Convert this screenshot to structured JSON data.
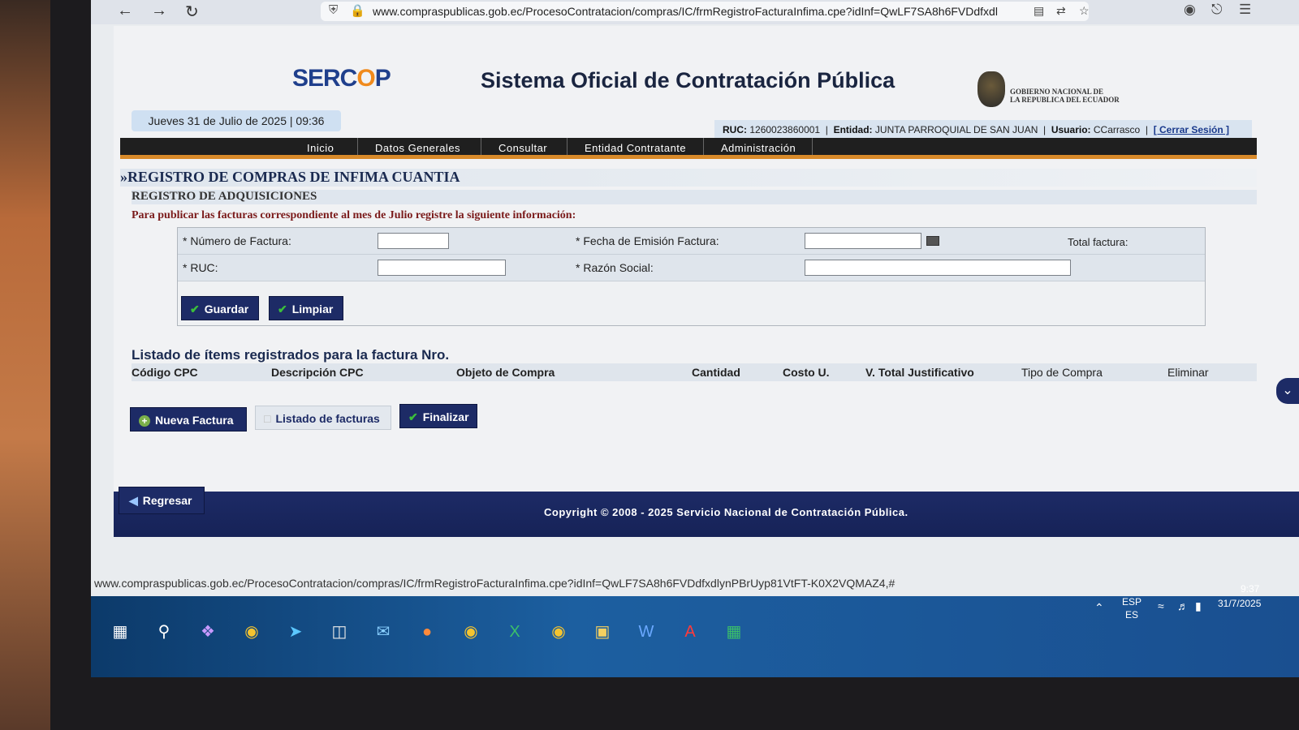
{
  "browser": {
    "url": "www.compraspublicas.gob.ec/ProcesoContratacion/compras/IC/frmRegistroFacturaInfima.cpe?idInf=QwLF7SA8h6FVDdfxdl"
  },
  "header": {
    "logo_main": "SERC",
    "logo_accent": "O",
    "logo_end": "P",
    "system_title": "Sistema Oficial de Contratación Pública",
    "gov_text_line1": "GOBIERNO NACIONAL DE",
    "gov_text_line2": "LA REPUBLICA DEL ECUADOR",
    "date": "Jueves 31 de Julio de 2025 | 09:36"
  },
  "infobar": {
    "ruc_label": "RUC:",
    "ruc_value": "1260023860001",
    "entity_label": "Entidad:",
    "entity_value": "JUNTA PARROQUIAL DE SAN JUAN",
    "user_label": "Usuario:",
    "user_value": "CCarrasco",
    "logout": "[ Cerrar Sesión ]"
  },
  "menu": {
    "items": [
      "Inicio",
      "Datos Generales",
      "Consultar",
      "Entidad Contratante",
      "Administración"
    ]
  },
  "section": {
    "title": "»REGISTRO DE COMPRAS DE INFIMA CUANTIA",
    "subtitle": "REGISTRO DE ADQUISICIONES",
    "instruction": "Para publicar las facturas correspondiente al mes de Julio registre la siguiente información:"
  },
  "form": {
    "invoice_number_label": "* Número de Factura:",
    "issue_date_label": "* Fecha de Emisión Factura:",
    "total_label": "Total factura:",
    "ruc_label": "* RUC:",
    "business_name_label": "* Razón Social:",
    "save_label": "Guardar",
    "clear_label": "Limpiar"
  },
  "items_list": {
    "title": "Listado de ítems registrados para la factura Nro.",
    "columns": [
      "Código CPC",
      "Descripción CPC",
      "Objeto de Compra",
      "Cantidad",
      "Costo U.",
      "V. Total Justificativo",
      "Tipo de Compra",
      "Eliminar"
    ]
  },
  "actions": {
    "new_invoice": "Nueva Factura",
    "invoice_list": "Listado de facturas",
    "finish": "Finalizar",
    "back": "Regresar"
  },
  "footer": {
    "copyright": "Copyright © 2008 - 2025 Servicio Nacional de Contratación Pública."
  },
  "status_bar": {
    "url": "www.compraspublicas.gob.ec/ProcesoContratacion/compras/IC/frmRegistroFacturaInfima.cpe?idInf=QwLF7SA8h6FVDdfxdlynPBrUyp81VtFT-K0X2VQMAZ4,#"
  },
  "taskbar": {
    "lang_top": "ESP",
    "lang_bottom": "ES",
    "time": "9:37",
    "date": "31/7/2025"
  },
  "colors": {
    "navy": "#1d2b66",
    "accent_orange": "#f08a1c",
    "instruction_red": "#7a1a1a"
  }
}
